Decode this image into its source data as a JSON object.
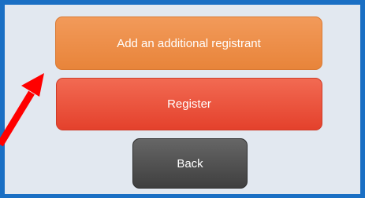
{
  "buttons": {
    "add_registrant_label": "Add an additional registrant",
    "register_label": "Register",
    "back_label": "Back"
  },
  "colors": {
    "frame_border": "#1a6fc4",
    "panel_background": "#e2e8f0",
    "add_button": "#e8843a",
    "register_button": "#e4412c",
    "back_button": "#4a4a4a",
    "annotation_arrow": "#ff0000"
  },
  "annotation": {
    "icon": "red-arrow-icon"
  }
}
